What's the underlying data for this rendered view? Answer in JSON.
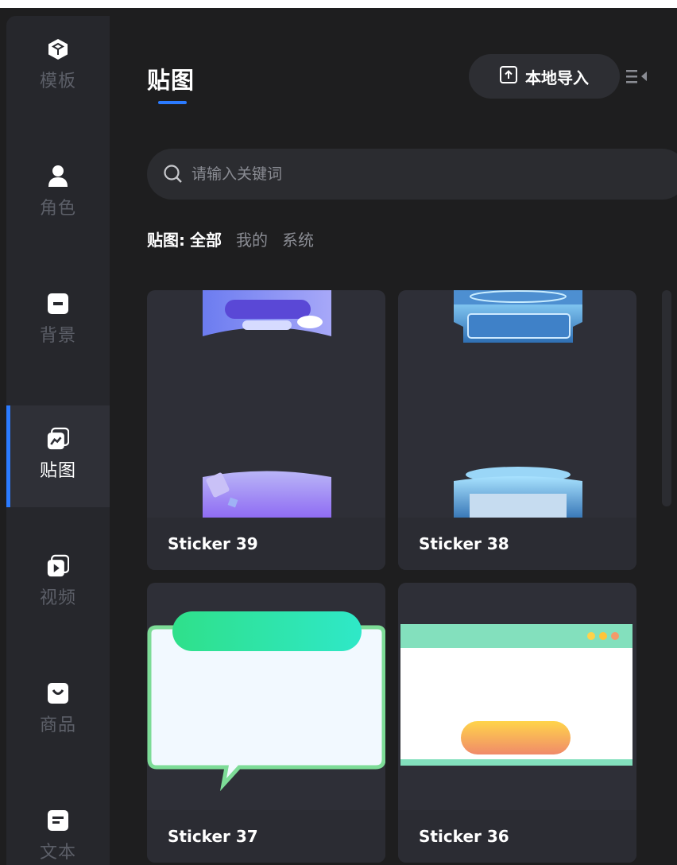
{
  "sidebar": {
    "items": [
      {
        "label": "模板",
        "icon": "cube-icon"
      },
      {
        "label": "角色",
        "icon": "person-icon"
      },
      {
        "label": "背景",
        "icon": "background-icon"
      },
      {
        "label": "贴图",
        "icon": "sticker-icon",
        "active": true
      },
      {
        "label": "视频",
        "icon": "video-icon"
      },
      {
        "label": "商品",
        "icon": "shopping-bag-icon"
      },
      {
        "label": "文本",
        "icon": "text-icon"
      }
    ]
  },
  "header": {
    "title": "贴图",
    "import_label": "本地导入",
    "import_icon": "upload-icon",
    "collapse_icon": "collapse-panel-icon"
  },
  "search": {
    "placeholder": "请输入关键词",
    "value": ""
  },
  "filter": {
    "label": "贴图:",
    "options": [
      "全部",
      "我的",
      "系统"
    ],
    "selected": "全部"
  },
  "stickers": [
    {
      "name": "Sticker 39"
    },
    {
      "name": "Sticker 38"
    },
    {
      "name": "Sticker 37"
    },
    {
      "name": "Sticker 36"
    }
  ],
  "colors": {
    "accent": "#2b7bff",
    "background": "#1e1e1f",
    "rail": "#26272c",
    "card": "#2e2f37"
  }
}
